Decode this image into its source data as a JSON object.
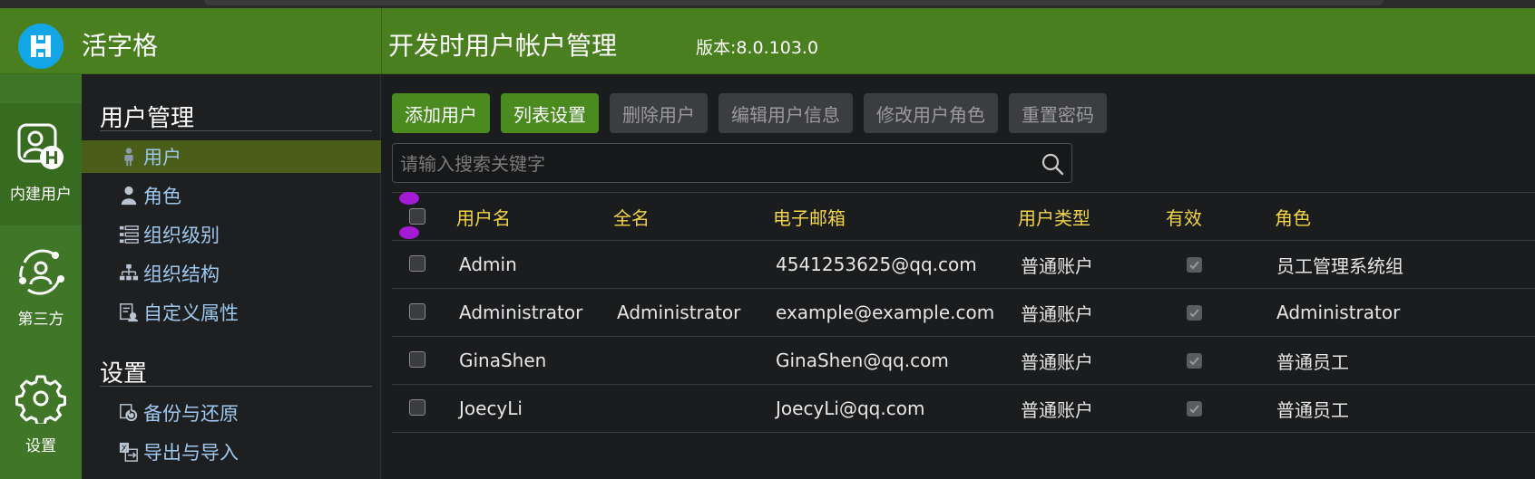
{
  "app": {
    "name": "活字格",
    "page_title": "开发时用户帐户管理",
    "version": "版本:8.0.103.0"
  },
  "rail": [
    {
      "label": "内建用户",
      "icon": "builtin-user-icon",
      "active": true
    },
    {
      "label": "第三方",
      "icon": "third-party-icon",
      "active": false
    },
    {
      "label": "设置",
      "icon": "gear-icon",
      "active": false
    }
  ],
  "side": {
    "section_user": "用户管理",
    "items_user": [
      {
        "label": "用户",
        "icon": "user-icon",
        "active": true
      },
      {
        "label": "角色",
        "icon": "role-icon",
        "active": false
      },
      {
        "label": "组织级别",
        "icon": "org-level-icon",
        "active": false
      },
      {
        "label": "组织结构",
        "icon": "org-structure-icon",
        "active": false
      },
      {
        "label": "自定义属性",
        "icon": "custom-attribute-icon",
        "active": false
      }
    ],
    "section_settings": "设置",
    "items_settings": [
      {
        "label": "备份与还原",
        "icon": "backup-restore-icon"
      },
      {
        "label": "导出与导入",
        "icon": "export-import-icon"
      }
    ]
  },
  "toolbar": {
    "add_user": "添加用户",
    "list_settings": "列表设置",
    "delete_user": "删除用户",
    "edit_user": "编辑用户信息",
    "change_role": "修改用户角色",
    "reset_password": "重置密码"
  },
  "search": {
    "placeholder": "请输入搜索关键字",
    "value": ""
  },
  "table": {
    "headers": {
      "username": "用户名",
      "fullname": "全名",
      "email": "电子邮箱",
      "type": "用户类型",
      "valid": "有效",
      "role": "角色"
    },
    "rows": [
      {
        "username": "Admin",
        "fullname": "",
        "email": "4541253625@qq.com",
        "type": "普通账户",
        "valid": true,
        "role": "员工管理系统组"
      },
      {
        "username": "Administrator",
        "fullname": "Administrator",
        "email": "example@example.com",
        "type": "普通账户",
        "valid": true,
        "role": "Administrator"
      },
      {
        "username": "GinaShen",
        "fullname": "",
        "email": "GinaShen@qq.com",
        "type": "普通账户",
        "valid": true,
        "role": "普通员工"
      },
      {
        "username": "JoecyLi",
        "fullname": "",
        "email": "JoecyLi@qq.com",
        "type": "普通账户",
        "valid": true,
        "role": "普通员工"
      }
    ]
  },
  "colors": {
    "header_green": "#4a7f1f",
    "button_green": "#4a8a1f",
    "header_text": "#f1d547",
    "menu_text": "#9ec7ee",
    "logo_blue": "#12a6e6",
    "drag_purple": "#a31bd4"
  }
}
